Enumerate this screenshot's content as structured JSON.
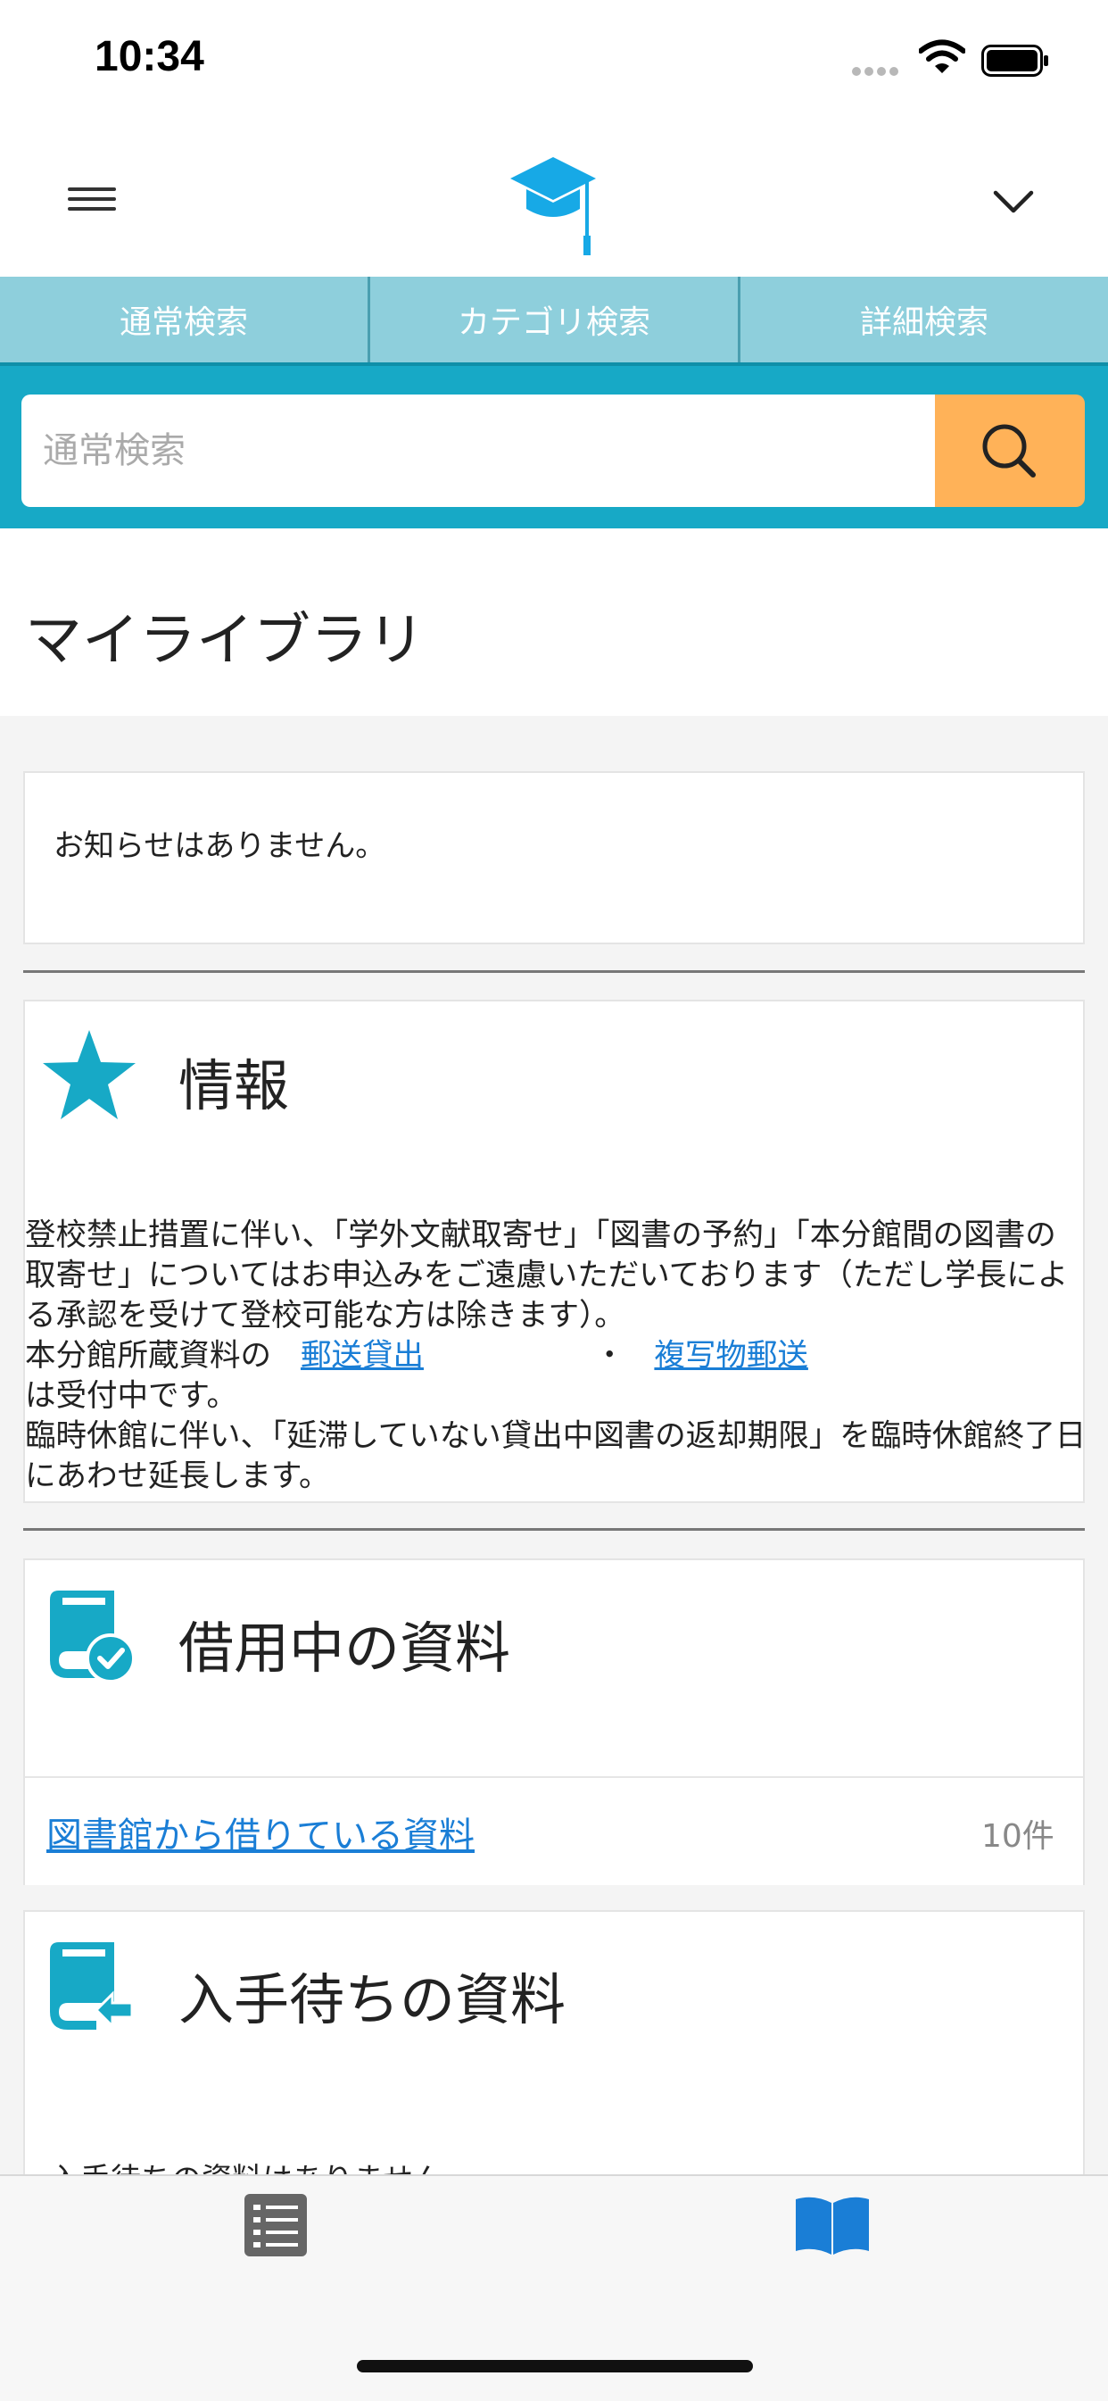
{
  "status_bar": {
    "time": "10:34"
  },
  "header": {
    "logo_icon": "graduation-cap-icon",
    "menu_icon": "hamburger-menu-icon",
    "dropdown_icon": "chevron-down-icon"
  },
  "tabs": [
    {
      "label": "通常検索"
    },
    {
      "label": "カテゴリ検索"
    },
    {
      "label": "詳細検索"
    }
  ],
  "search": {
    "placeholder": "通常検索",
    "button_icon": "search-icon"
  },
  "page": {
    "title": "マイライブラリ"
  },
  "notice": {
    "text": "お知らせはありません。"
  },
  "info": {
    "heading": "情報",
    "icon": "star-icon",
    "line1": "登校禁止措置に伴い、「学外文献取寄せ」「図書の予約」「本分館間の図書の取寄せ」についてはお申込みをご遠慮いただいております（ただし学長による承認を受けて登校可能な方は除きます）。",
    "line2_prefix": "本分館所蔵資料の",
    "link_postal_loan": "郵送貸出",
    "separator": "・",
    "link_copy_mail": "複写物郵送",
    "line2_suffix": "は受付中です。",
    "line3": "臨時休館に伴い、「延滞していない貸出中図書の返却期限」を臨時休館終了日にあわせ延長します。"
  },
  "borrowed": {
    "heading": "借用中の資料",
    "icon": "book-check-icon",
    "link": "図書館から借りている資料",
    "count": "10件"
  },
  "waiting": {
    "heading": "入手待ちの資料",
    "icon": "book-return-icon",
    "text": "入手待ちの資料はありません。"
  },
  "tabbar": {
    "left_icon": "list-icon",
    "right_icon": "open-book-icon"
  },
  "colors": {
    "accent": "#17a9c6",
    "tab_bg": "#8ecfdc",
    "search_button": "#ffb258",
    "link": "#1a7ed6",
    "active_tab_icon": "#1a7ed6"
  }
}
